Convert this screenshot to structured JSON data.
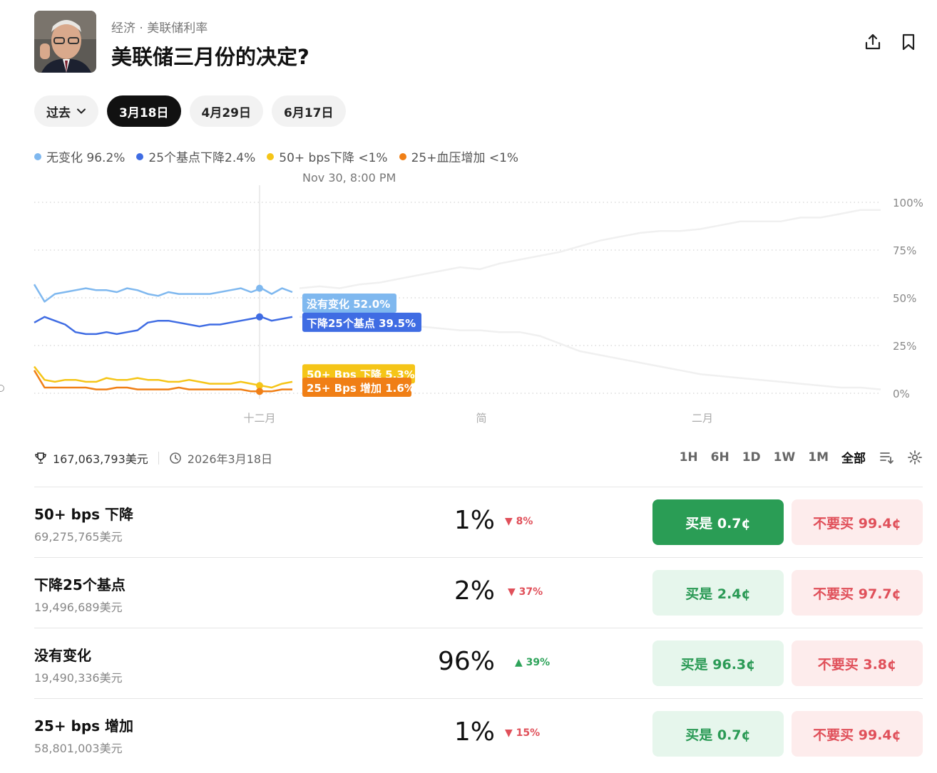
{
  "header": {
    "breadcrumb": "经济 · 美联储利率",
    "title": "美联储三月份的决定?"
  },
  "tabs": [
    {
      "label": "过去",
      "active": false,
      "dropdown": true
    },
    {
      "label": "3月18日",
      "active": true
    },
    {
      "label": "4月29日",
      "active": false
    },
    {
      "label": "6月17日",
      "active": false
    }
  ],
  "legend": [
    {
      "label": "无变化 96.2%",
      "color": "#7fb8ef"
    },
    {
      "label": "25个基点下降2.4%",
      "color": "#3f6ce3"
    },
    {
      "label": "50+ bps下降 <1%",
      "color": "#f5c518"
    },
    {
      "label": "25+血压增加 <1%",
      "color": "#f07f16"
    }
  ],
  "chart_data": {
    "type": "line",
    "hover_date": "Nov 30, 8:00 PM",
    "x_ticks": [
      "十二月",
      "简",
      "二月"
    ],
    "y_ticks": [
      "100%",
      "75%",
      "50%",
      "25%",
      "0%"
    ],
    "ylim": [
      0,
      100
    ],
    "series": [
      {
        "name": "没有变化",
        "color": "#7fb8ef",
        "tooltip": "没有变化 52.0%",
        "values": [
          57,
          48,
          52,
          53,
          54,
          55,
          54,
          54,
          53,
          55,
          54,
          52,
          51,
          53,
          52,
          52,
          52,
          52,
          53,
          54,
          55,
          53,
          55,
          52,
          55,
          53
        ]
      },
      {
        "name": "下降25个基点",
        "color": "#3f6ce3",
        "tooltip": "下降25个基点 39.5%",
        "values": [
          37,
          40,
          38,
          36,
          32,
          31,
          31,
          32,
          31,
          32,
          33,
          37,
          38,
          38,
          37,
          36,
          35,
          36,
          36,
          37,
          38,
          39,
          40,
          38,
          39,
          40
        ]
      },
      {
        "name": "50+ Bps 下降",
        "color": "#f5c518",
        "tooltip": "50+ Bps 下降 5.3%",
        "values": [
          14,
          7,
          6,
          7,
          7,
          6,
          6,
          8,
          7,
          7,
          8,
          7,
          7,
          6,
          6,
          7,
          6,
          5,
          5,
          5,
          6,
          5,
          4,
          3,
          5,
          6
        ]
      },
      {
        "name": "25+ Bps 增加",
        "color": "#f07f16",
        "tooltip": "25+ Bps 增加 1.6%",
        "values": [
          12,
          3,
          3,
          3,
          3,
          3,
          2,
          2,
          3,
          3,
          2,
          2,
          2,
          2,
          3,
          2,
          2,
          2,
          2,
          2,
          2,
          1,
          1,
          1,
          2,
          2
        ]
      }
    ],
    "faded_series": [
      {
        "values": [
          55,
          56,
          55,
          57,
          58,
          60,
          62,
          64,
          66,
          65,
          68,
          70,
          72,
          74,
          77,
          80,
          82,
          84,
          85,
          85,
          86,
          88,
          90,
          90,
          90,
          92,
          92,
          94,
          96,
          96
        ]
      },
      {
        "values": [
          40,
          39,
          38,
          37,
          36,
          35,
          35,
          34,
          33,
          33,
          32,
          32,
          30,
          26,
          22,
          20,
          18,
          16,
          14,
          12,
          10,
          9,
          8,
          7,
          6,
          5,
          4,
          3,
          3,
          2
        ]
      }
    ]
  },
  "stats": {
    "volume": "167,063,793美元",
    "end_date": "2026年3月18日"
  },
  "ranges": [
    {
      "label": "1H",
      "active": false
    },
    {
      "label": "6H",
      "active": false
    },
    {
      "label": "1D",
      "active": false
    },
    {
      "label": "1W",
      "active": false
    },
    {
      "label": "1M",
      "active": false
    },
    {
      "label": "全部",
      "active": true
    }
  ],
  "outcomes": [
    {
      "name": "50+ bps 下降",
      "volume": "69,275,765美元",
      "pct": "1%",
      "change": "8%",
      "dir": "down",
      "yes": "买是 0.7¢",
      "no": "不要买 99.4¢",
      "yes_solid": true
    },
    {
      "name": "下降25个基点",
      "volume": "19,496,689美元",
      "pct": "2%",
      "change": "37%",
      "dir": "down",
      "yes": "买是 2.4¢",
      "no": "不要买 97.7¢",
      "yes_solid": false
    },
    {
      "name": "没有变化",
      "volume": "19,490,336美元",
      "pct": "96%",
      "change": "39%",
      "dir": "up",
      "yes": "买是 96.3¢",
      "no": "不要买 3.8¢",
      "yes_solid": false
    },
    {
      "name": "25+ bps 增加",
      "volume": "58,801,003美元",
      "pct": "1%",
      "change": "15%",
      "dir": "down",
      "yes": "买是 0.7¢",
      "no": "不要买 99.4¢",
      "yes_solid": false
    }
  ]
}
